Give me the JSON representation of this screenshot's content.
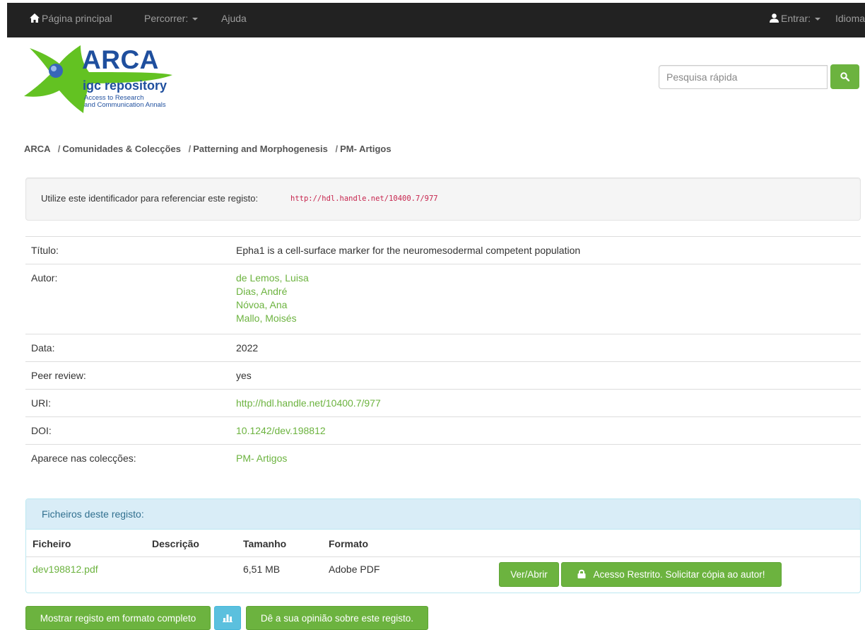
{
  "navbar": {
    "home_label": "Página principal",
    "browse_label": "Percorrer:",
    "help_label": "Ajuda",
    "login_label": "Entrar:",
    "language_label": "Idioma"
  },
  "logo": {
    "title": "ARCA",
    "subtitle": "igc repository",
    "tagline_1": "Access to Research",
    "tagline_2": "and Communication Annals"
  },
  "search": {
    "placeholder": "Pesquisa rápida"
  },
  "breadcrumb": {
    "items": [
      "ARCA",
      "Comunidades & Colecções",
      "Patterning and Morphogenesis",
      "PM- Artigos"
    ],
    "separator": "/"
  },
  "identifier": {
    "label": "Utilize este identificador para referenciar este registo:",
    "value": "http://hdl.handle.net/10400.7/977"
  },
  "metadata": {
    "title_label": "Título:",
    "title_value": "Epha1 is a cell-surface marker for the neuromesodermal competent population",
    "author_label": "Autor:",
    "authors": [
      "de Lemos, Luisa",
      "Dias, André",
      "Nóvoa, Ana",
      "Mallo, Moisés"
    ],
    "date_label": "Data:",
    "date_value": "2022",
    "peer_label": "Peer review:",
    "peer_value": "yes",
    "uri_label": "URI:",
    "uri_value": "http://hdl.handle.net/10400.7/977",
    "doi_label": "DOI:",
    "doi_value": "10.1242/dev.198812",
    "collections_label": "Aparece nas colecções:",
    "collections_value": "PM- Artigos"
  },
  "files": {
    "heading": "Ficheiros deste registo:",
    "columns": [
      "Ficheiro",
      "Descrição",
      "Tamanho",
      "Formato"
    ],
    "rows": [
      {
        "name": "dev198812.pdf",
        "description": "",
        "size": "6,51 MB",
        "format": "Adobe PDF"
      }
    ],
    "open_label": "Ver/Abrir",
    "restricted_label": "Acesso Restrito. Solicitar cópia ao autor!"
  },
  "actions": {
    "full_record_label": "Mostrar registo em formato completo",
    "stats_icon": "bar-chart-icon",
    "feedback_label": "Dê a sua opinião sobre este registo."
  },
  "colors": {
    "accent": "#6cb33f",
    "navbar": "#222222",
    "logo_blue": "#1f4f9e",
    "info": "#5bc0de"
  }
}
